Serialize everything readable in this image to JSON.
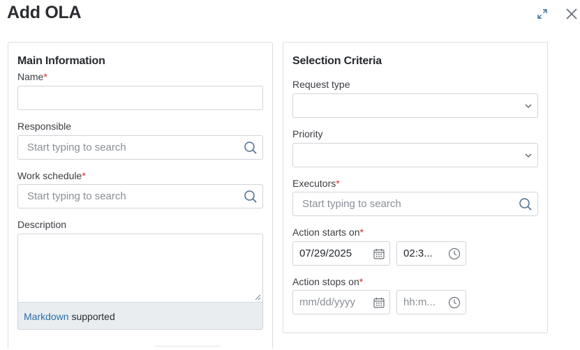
{
  "dialog": {
    "title": "Add OLA"
  },
  "main_info": {
    "title": "Main Information",
    "name_label": "Name",
    "name_value": "",
    "responsible_label": "Responsible",
    "responsible_placeholder": "Start typing to search",
    "work_schedule_label": "Work schedule",
    "work_schedule_placeholder": "Start typing to search",
    "description_label": "Description",
    "description_value": "",
    "markdown_link": "Markdown",
    "markdown_suffix": " supported"
  },
  "selection": {
    "title": "Selection Criteria",
    "request_type_label": "Request type",
    "request_type_value": "",
    "priority_label": "Priority",
    "priority_value": "",
    "executors_label": "Executors",
    "executors_placeholder": "Start typing to search",
    "starts_label": "Action starts on",
    "starts_date": "07/29/2025",
    "starts_time": "02:3...",
    "stops_label": "Action stops on",
    "stops_date_placeholder": "mm/dd/yyyy",
    "stops_time_placeholder": "hh:m..."
  },
  "required_mark": "*",
  "colors": {
    "required": "#d62b2b",
    "link": "#2d6fa6",
    "icon": "#4a6b8a",
    "border": "#cfd4da"
  }
}
